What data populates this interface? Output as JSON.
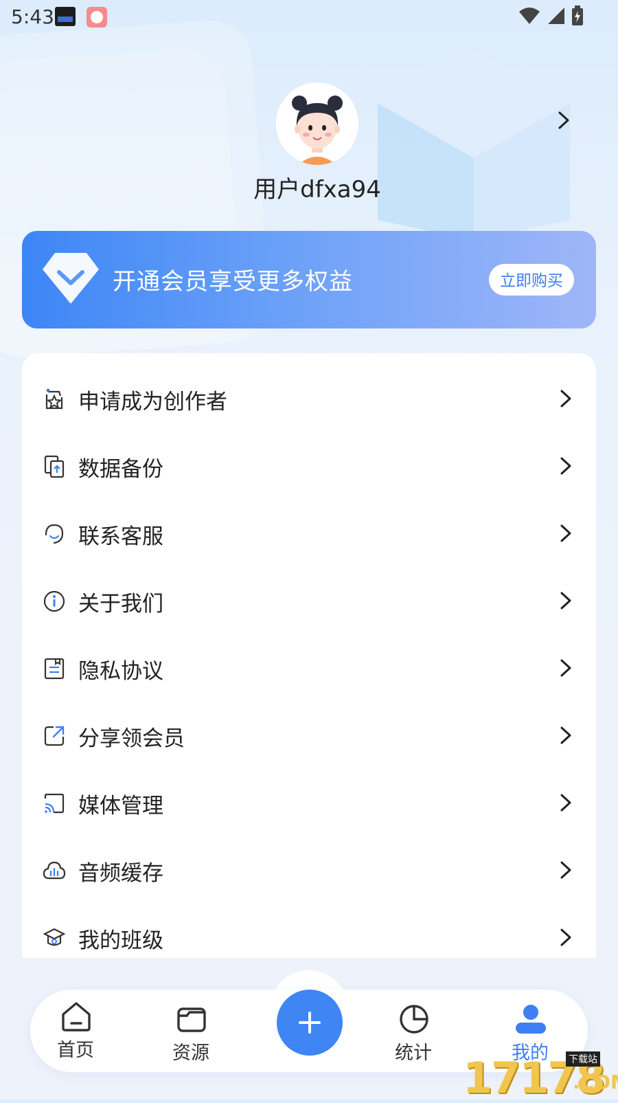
{
  "status_bar": {
    "time": "5:43",
    "icons": [
      "wifi-icon",
      "signal-icon",
      "battery-charging-icon"
    ]
  },
  "profile": {
    "username": "用户dfxa94"
  },
  "vip_banner": {
    "text": "开通会员享受更多权益",
    "buy_label": "立即购买"
  },
  "menu": {
    "items": [
      {
        "label": "申请成为创作者",
        "icon": "creator-star-icon"
      },
      {
        "label": "数据备份",
        "icon": "backup-icon"
      },
      {
        "label": "联系客服",
        "icon": "customer-service-icon"
      },
      {
        "label": "关于我们",
        "icon": "info-icon"
      },
      {
        "label": "隐私协议",
        "icon": "privacy-document-icon"
      },
      {
        "label": "分享领会员",
        "icon": "share-icon"
      },
      {
        "label": "媒体管理",
        "icon": "cast-icon"
      },
      {
        "label": "音频缓存",
        "icon": "cloud-audio-icon"
      },
      {
        "label": "我的班级",
        "icon": "class-icon"
      }
    ]
  },
  "bottom_nav": {
    "items": [
      {
        "label": "首页",
        "icon": "home-icon"
      },
      {
        "label": "资源",
        "icon": "folder-icon"
      },
      {
        "label": "统计",
        "icon": "pie-chart-icon"
      },
      {
        "label": "我的",
        "icon": "person-icon",
        "active": true
      }
    ],
    "fab_icon": "plus-icon"
  },
  "watermark": {
    "number": "17178",
    "top_text": "下载站",
    "suffix": ".COM"
  },
  "colors": {
    "accent": "#3f86f4",
    "active_nav": "#3e7ff4"
  }
}
